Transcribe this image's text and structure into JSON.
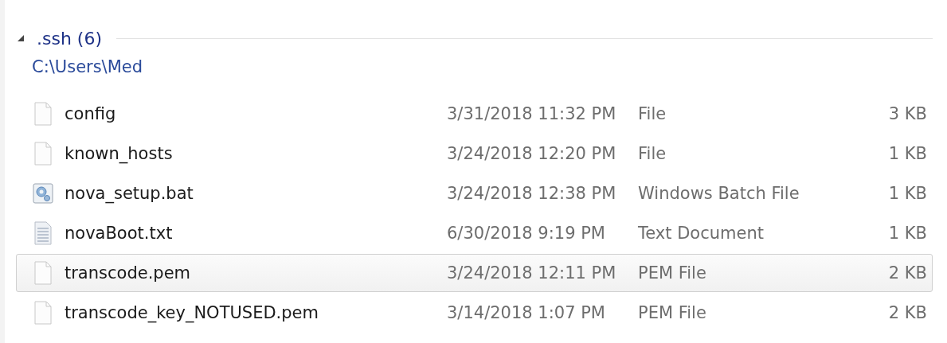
{
  "group": {
    "title": ".ssh (6)",
    "expanded": true,
    "path": "C:\\Users\\Med"
  },
  "files": [
    {
      "name": "config",
      "date": "3/31/2018 11:32 PM",
      "type": "File",
      "size": "3 KB",
      "kind": "blank",
      "hovered": false
    },
    {
      "name": "known_hosts",
      "date": "3/24/2018 12:20 PM",
      "type": "File",
      "size": "1 KB",
      "kind": "blank",
      "hovered": false
    },
    {
      "name": "nova_setup.bat",
      "date": "3/24/2018 12:38 PM",
      "type": "Windows Batch File",
      "size": "1 KB",
      "kind": "batch",
      "hovered": false
    },
    {
      "name": "novaBoot.txt",
      "date": "6/30/2018 9:19 PM",
      "type": "Text Document",
      "size": "1 KB",
      "kind": "text",
      "hovered": false
    },
    {
      "name": "transcode.pem",
      "date": "3/24/2018 12:11 PM",
      "type": "PEM File",
      "size": "2 KB",
      "kind": "blank",
      "hovered": true
    },
    {
      "name": "transcode_key_NOTUSED.pem",
      "date": "3/14/2018 1:07 PM",
      "type": "PEM File",
      "size": "2 KB",
      "kind": "blank",
      "hovered": false
    }
  ]
}
